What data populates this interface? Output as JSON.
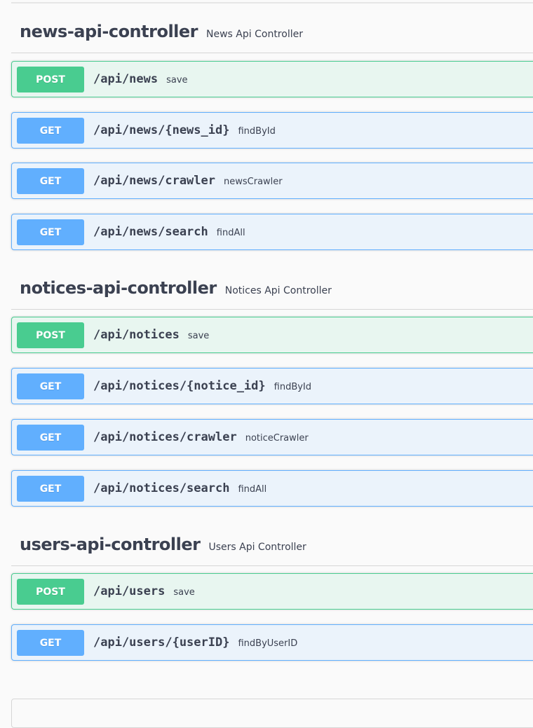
{
  "sections": [
    {
      "name": "news-api-controller",
      "description": "News Api Controller",
      "operations": [
        {
          "method": "POST",
          "path": "/api/news",
          "summary": "save"
        },
        {
          "method": "GET",
          "path": "/api/news/{news_id}",
          "summary": "findById"
        },
        {
          "method": "GET",
          "path": "/api/news/crawler",
          "summary": "newsCrawler"
        },
        {
          "method": "GET",
          "path": "/api/news/search",
          "summary": "findAll"
        }
      ]
    },
    {
      "name": "notices-api-controller",
      "description": "Notices Api Controller",
      "operations": [
        {
          "method": "POST",
          "path": "/api/notices",
          "summary": "save"
        },
        {
          "method": "GET",
          "path": "/api/notices/{notice_id}",
          "summary": "findById"
        },
        {
          "method": "GET",
          "path": "/api/notices/crawler",
          "summary": "noticeCrawler"
        },
        {
          "method": "GET",
          "path": "/api/notices/search",
          "summary": "findAll"
        }
      ]
    },
    {
      "name": "users-api-controller",
      "description": "Users Api Controller",
      "operations": [
        {
          "method": "POST",
          "path": "/api/users",
          "summary": "save"
        },
        {
          "method": "GET",
          "path": "/api/users/{userID}",
          "summary": "findByUserID"
        }
      ]
    }
  ],
  "colors": {
    "post": "#49cc90",
    "get": "#61affe",
    "text": "#3b4151"
  }
}
